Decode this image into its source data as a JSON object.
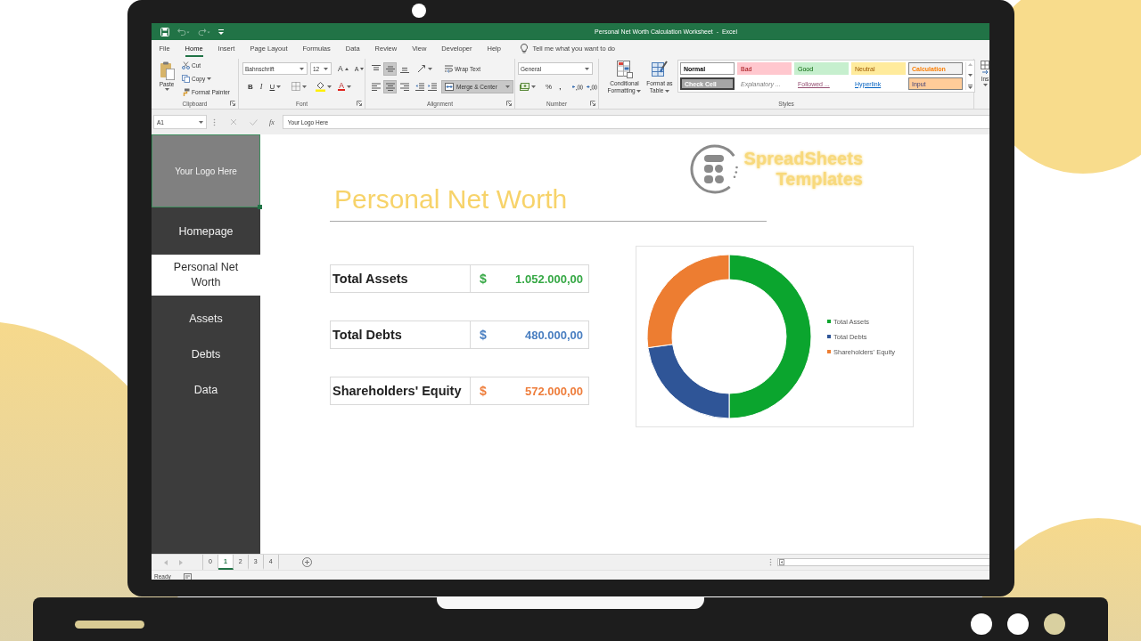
{
  "window": {
    "title": "Personal Net Worth Calculation Worksheet  -  Excel"
  },
  "quick_access": [
    {
      "kind": "save",
      "disabled": false
    },
    {
      "kind": "undo",
      "disabled": true
    },
    {
      "kind": "redo",
      "disabled": true
    },
    {
      "kind": "customize",
      "disabled": false
    }
  ],
  "menu_tabs": [
    {
      "label": "File",
      "selected": false
    },
    {
      "label": "Home",
      "selected": true
    },
    {
      "label": "Insert",
      "selected": false
    },
    {
      "label": "Page Layout",
      "selected": false
    },
    {
      "label": "Formulas",
      "selected": false
    },
    {
      "label": "Data",
      "selected": false
    },
    {
      "label": "Review",
      "selected": false
    },
    {
      "label": "View",
      "selected": false
    },
    {
      "label": "Developer",
      "selected": false
    },
    {
      "label": "Help",
      "selected": false
    }
  ],
  "tell_me": {
    "placeholder": "Tell me what you want to do"
  },
  "ribbon": {
    "clipboard": {
      "paste": "Paste",
      "cut": "Cut",
      "copy": "Copy",
      "format_painter": "Format Painter",
      "label": "Clipboard"
    },
    "font": {
      "name": "Bahnschrift",
      "size": "12",
      "grow": "A",
      "shrink": "A",
      "bold": "B",
      "italic": "I",
      "underline": "U",
      "font_color": "A",
      "label": "Font"
    },
    "alignment": {
      "vertical": [
        {
          "kind": "top",
          "pressed": false
        },
        {
          "kind": "middle",
          "pressed": true
        },
        {
          "kind": "bottom",
          "pressed": false
        }
      ],
      "horizontal": [
        {
          "kind": "left",
          "pressed": false
        },
        {
          "kind": "center",
          "pressed": true
        },
        {
          "kind": "right",
          "pressed": false
        }
      ],
      "wrap_text": {
        "label": "Wrap Text",
        "pressed": false
      },
      "merge": {
        "label": "Merge & Center",
        "pressed": true
      },
      "label": "Alignment"
    },
    "number": {
      "format": "General",
      "percent": "%",
      "comma": ",",
      "label": "Number"
    },
    "styles": {
      "conditional_formatting": "Conditional Formatting",
      "format_as_table": "Format as Table",
      "gallery": [
        {
          "label": "Normal",
          "kind": "normal"
        },
        {
          "label": "Bad",
          "kind": "bad"
        },
        {
          "label": "Good",
          "kind": "good"
        },
        {
          "label": "Neutral",
          "kind": "neutral"
        },
        {
          "label": "Calculation",
          "kind": "calculation"
        },
        {
          "label": "Check Cell",
          "kind": "check"
        },
        {
          "label": "Explanatory ...",
          "kind": "explanatory"
        },
        {
          "label": "Followed ...",
          "kind": "followed"
        },
        {
          "label": "Hyperlink",
          "kind": "hyperlink"
        },
        {
          "label": "Input",
          "kind": "input"
        }
      ],
      "label": "Styles"
    },
    "cells": {
      "insert": "Ins"
    }
  },
  "formula_bar": {
    "name_box": "A1",
    "cancel": {
      "disabled": true
    },
    "enter": {
      "disabled": true
    },
    "insert_function": "fx",
    "formula": "Your Logo Here"
  },
  "sidebar": {
    "logo": {
      "text": "Your Logo Here",
      "selected": true
    },
    "items": [
      {
        "label": "Homepage",
        "selected": false
      },
      {
        "label": "Personal Net Worth",
        "selected": true
      },
      {
        "label": "Assets",
        "selected": false
      },
      {
        "label": "Debts",
        "selected": false
      },
      {
        "label": "Data",
        "selected": false
      }
    ]
  },
  "brand": {
    "line_1": "SpreadSheets",
    "line_2": "Templates"
  },
  "heading": "Personal Net Worth",
  "summary": [
    {
      "label": "Total Assets",
      "currency": "$",
      "value": "1.052.000,00",
      "color": "#36a845"
    },
    {
      "label": "Total Debts",
      "currency": "$",
      "value": "480.000,00",
      "color": "#4a7fc1"
    },
    {
      "label": "Shareholders' Equity",
      "currency": "$",
      "value": "572.000,00",
      "color": "#ee7d3b"
    }
  ],
  "chart": {
    "chart_data": {
      "type": "donut",
      "values": [
        50,
        22.81,
        27.19
      ]
    },
    "legend": [
      {
        "label": "Total Assets",
        "color": "#0ba52e"
      },
      {
        "label": "Total Debts",
        "color": "#2f5597"
      },
      {
        "label": "Shareholders' Equity",
        "color": "#ed7d31"
      }
    ]
  },
  "sheet_nav": [
    {
      "kind": "previous",
      "disabled": true
    },
    {
      "kind": "next",
      "disabled": true
    }
  ],
  "sheet_tabs": [
    {
      "label": "0",
      "selected": false
    },
    {
      "label": "1",
      "selected": true
    },
    {
      "label": "2",
      "selected": false
    },
    {
      "label": "3",
      "selected": false
    },
    {
      "label": "4",
      "selected": false
    }
  ],
  "status_bar": {
    "status": "Ready"
  }
}
